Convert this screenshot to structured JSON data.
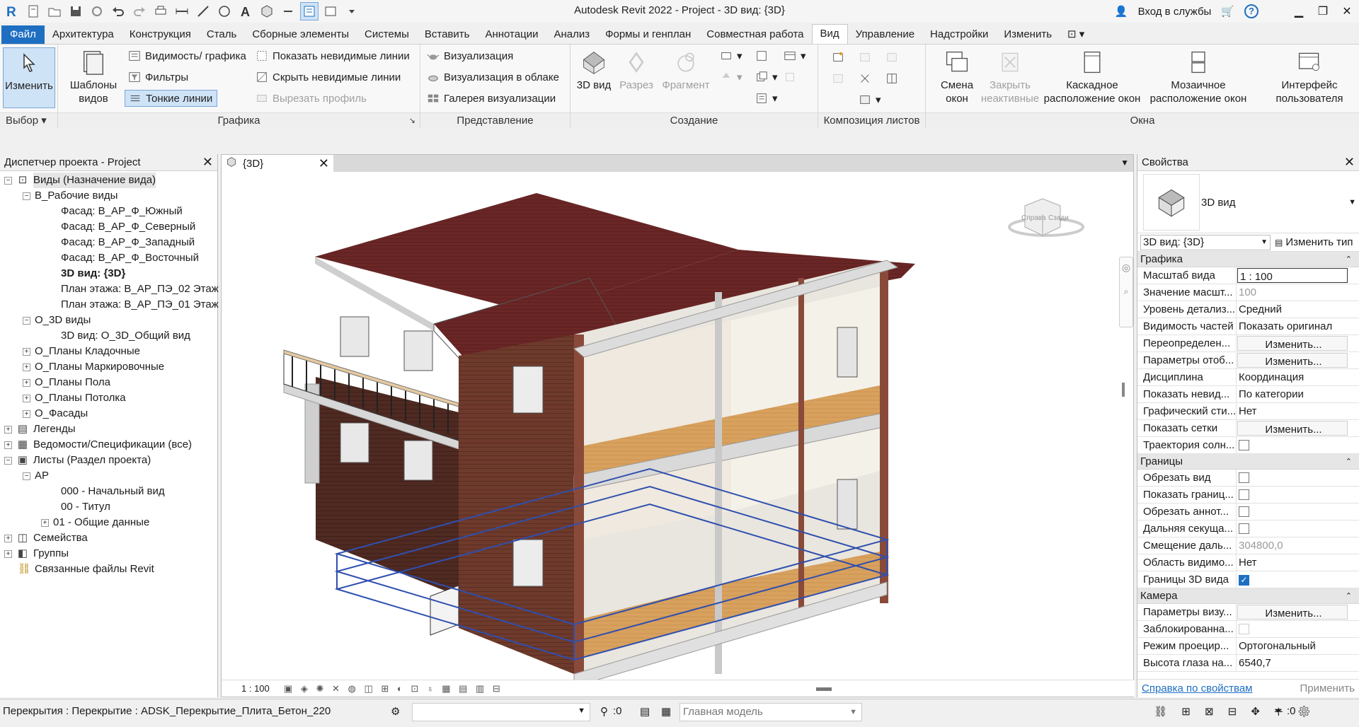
{
  "window": {
    "title": "Autodesk Revit 2022 - Project - 3D вид: {3D}",
    "signin": "Вход в службы",
    "minimize": "▁",
    "restore": "❐",
    "close": "✕"
  },
  "menu": {
    "tabs": [
      "Файл",
      "Архитектура",
      "Конструкция",
      "Сталь",
      "Сборные элементы",
      "Системы",
      "Вставить",
      "Аннотации",
      "Анализ",
      "Формы и генплан",
      "Совместная работа",
      "Вид",
      "Управление",
      "Надстройки",
      "Изменить"
    ],
    "active": "Вид"
  },
  "ribbon": {
    "select_panel": {
      "label": "Выбор",
      "modify": "Изменить"
    },
    "graphics_panel": {
      "label": "Графика",
      "templates": "Шаблоны видов",
      "visibility": "Видимость/ графика",
      "filters": "Фильтры",
      "thin_lines": "Тонкие линии",
      "show_hidden": "Показать невидимые линии",
      "remove_hidden": "Скрыть невидимые линии",
      "cut_profile": "Вырезать профиль"
    },
    "presentation_panel": {
      "label": "Представление",
      "render": "Визуализация",
      "render_cloud": "Визуализация  в облаке",
      "render_gallery": "Галерея  визуализации"
    },
    "create_panel": {
      "label": "Создание",
      "view3d": "3D вид",
      "section": "Разрез",
      "callout": "Фрагмент"
    },
    "sheet_panel": {
      "label": "Композиция листов"
    },
    "window_panel": {
      "label": "Окна",
      "switch": "Смена окон",
      "close_inactive": "Закрыть неактивные",
      "cascade": "Каскадное расположение окон",
      "tile": "Мозаичное расположение окон",
      "ui": "Интерфейс пользователя"
    }
  },
  "project_browser": {
    "title": "Диспетчер проекта - Project",
    "items": [
      {
        "label": "Виды (Назначение вида)",
        "level": 0,
        "exp": "−",
        "icon": "views-icon",
        "selected": true
      },
      {
        "label": "В_Рабочие виды",
        "level": 1,
        "exp": "−"
      },
      {
        "label": "Фасад: В_АР_Ф_Южный",
        "level": 2
      },
      {
        "label": "Фасад: В_АР_Ф_Северный",
        "level": 2
      },
      {
        "label": "Фасад: В_АР_Ф_Западный",
        "level": 2
      },
      {
        "label": "Фасад: В_АР_Ф_Восточный",
        "level": 2
      },
      {
        "label": "3D вид: {3D}",
        "level": 2,
        "bold": true
      },
      {
        "label": "План этажа: В_АР_ПЭ_02 Этаж",
        "level": 2
      },
      {
        "label": "План этажа: В_АР_ПЭ_01 Этаж",
        "level": 2
      },
      {
        "label": "О_3D виды",
        "level": 1,
        "exp": "−"
      },
      {
        "label": "3D вид: О_3D_Общий вид",
        "level": 2
      },
      {
        "label": "О_Планы Кладочные",
        "level": 1,
        "exp": "+"
      },
      {
        "label": "О_Планы Маркировочные",
        "level": 1,
        "exp": "+"
      },
      {
        "label": "О_Планы Пола",
        "level": 1,
        "exp": "+"
      },
      {
        "label": "О_Планы Потолка",
        "level": 1,
        "exp": "+"
      },
      {
        "label": "О_Фасады",
        "level": 1,
        "exp": "+"
      },
      {
        "label": "Легенды",
        "level": 0,
        "exp": "+",
        "icon": "legend-icon"
      },
      {
        "label": "Ведомости/Спецификации (все)",
        "level": 0,
        "exp": "+",
        "icon": "schedule-icon"
      },
      {
        "label": "Листы (Раздел проекта)",
        "level": 0,
        "exp": "−",
        "icon": "sheets-icon"
      },
      {
        "label": "АР",
        "level": 1,
        "exp": "−"
      },
      {
        "label": "000 - Начальный вид",
        "level": 2
      },
      {
        "label": "00 - Титул",
        "level": 2
      },
      {
        "label": "01 - Общие данные",
        "level": 2,
        "exp": "+"
      },
      {
        "label": "Семейства",
        "level": 0,
        "exp": "+",
        "icon": "families-icon"
      },
      {
        "label": "Группы",
        "level": 0,
        "exp": "+",
        "icon": "groups-icon"
      },
      {
        "label": "Связанные файлы Revit",
        "level": 0,
        "icon": "links-icon"
      }
    ]
  },
  "view": {
    "tab_label": "{3D}",
    "scale": "1 : 100",
    "viewcube_right": "Справа",
    "viewcube_back": "Сзади"
  },
  "properties": {
    "title": "Свойства",
    "type_name": "3D вид",
    "type_selector": "3D вид: {3D}",
    "edit_type": "Изменить тип",
    "groups": [
      {
        "name": "Графика",
        "rows": [
          {
            "name": "Масштаб вида",
            "value": "1 : 100",
            "kind": "input"
          },
          {
            "name": "Значение масшт...",
            "value": "100",
            "kind": "gray"
          },
          {
            "name": "Уровень детализ...",
            "value": "Средний"
          },
          {
            "name": "Видимость частей",
            "value": "Показать оригинал"
          },
          {
            "name": "Переопределен...",
            "value": "Изменить...",
            "kind": "btn"
          },
          {
            "name": "Параметры отоб...",
            "value": "Изменить...",
            "kind": "btn"
          },
          {
            "name": "Дисциплина",
            "value": "Координация"
          },
          {
            "name": "Показать невид...",
            "value": "По категории"
          },
          {
            "name": "Графический сти...",
            "value": "Нет"
          },
          {
            "name": "Показать сетки",
            "value": "Изменить...",
            "kind": "btn"
          },
          {
            "name": "Траектория солн...",
            "value": "",
            "kind": "check"
          }
        ]
      },
      {
        "name": "Границы",
        "rows": [
          {
            "name": "Обрезать вид",
            "value": "",
            "kind": "check"
          },
          {
            "name": "Показать границ...",
            "value": "",
            "kind": "check"
          },
          {
            "name": "Обрезать аннот...",
            "value": "",
            "kind": "check"
          },
          {
            "name": "Дальняя секуща...",
            "value": "",
            "kind": "check"
          },
          {
            "name": "Смещение даль...",
            "value": "304800,0",
            "kind": "gray"
          },
          {
            "name": "Область видимо...",
            "value": "Нет"
          },
          {
            "name": "Границы 3D вида",
            "value": "✓",
            "kind": "checkon"
          }
        ]
      },
      {
        "name": "Камера",
        "rows": [
          {
            "name": "Параметры визу...",
            "value": "Изменить...",
            "kind": "btn"
          },
          {
            "name": "Заблокированна...",
            "value": "",
            "kind": "checkgray"
          },
          {
            "name": "Режим проецир...",
            "value": "Ортогональный"
          },
          {
            "name": "Высота глаза на...",
            "value": "6540,7"
          }
        ]
      }
    ],
    "help_link": "Справка по свойствам",
    "apply": "Применить"
  },
  "statusbar": {
    "message": "Перекрытия : Перекрытие : ADSK_Перекрытие_Плита_Бетон_220",
    "zero1": ":0",
    "model": "Главная модель",
    "zero2": ":0"
  }
}
